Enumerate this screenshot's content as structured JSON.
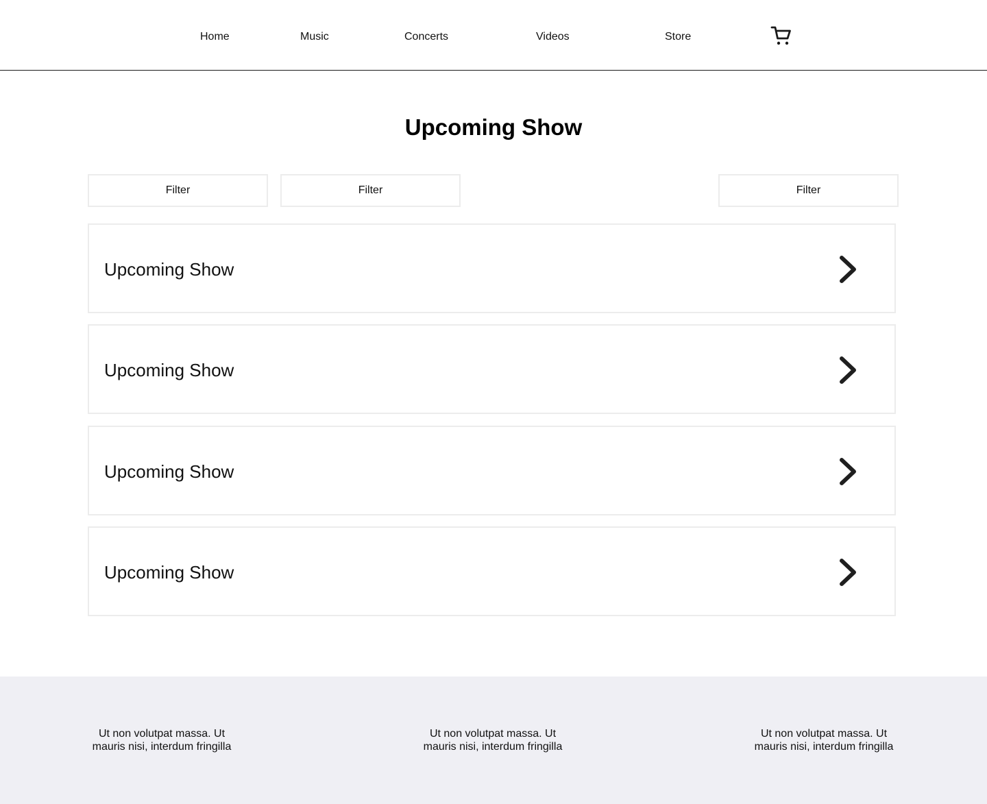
{
  "nav": {
    "items": [
      {
        "label": "Home"
      },
      {
        "label": "Music"
      },
      {
        "label": "Concerts"
      },
      {
        "label": "Videos"
      },
      {
        "label": "Store"
      }
    ],
    "cart_icon": "cart-icon"
  },
  "main": {
    "title": "Upcoming Show",
    "filters": [
      {
        "label": "Filter"
      },
      {
        "label": "Filter"
      },
      {
        "label": "Filter"
      }
    ],
    "shows": [
      {
        "label": "Upcoming Show",
        "icon": "chevron-right-icon"
      },
      {
        "label": "Upcoming Show",
        "icon": "chevron-right-icon"
      },
      {
        "label": "Upcoming Show",
        "icon": "chevron-right-icon"
      },
      {
        "label": "Upcoming Show",
        "icon": "chevron-right-icon"
      }
    ]
  },
  "footer": {
    "columns": [
      {
        "line1": "Ut non volutpat massa. Ut",
        "line2": "mauris nisi, interdum fringilla"
      },
      {
        "line1": "Ut non volutpat massa. Ut",
        "line2": "mauris nisi, interdum fringilla"
      },
      {
        "line1": "Ut non volutpat massa. Ut",
        "line2": "mauris nisi, interdum fringilla"
      }
    ],
    "background": "#efeff4"
  },
  "colors": {
    "text": "#111111",
    "border": "#ececec",
    "divider": "#1a1a1a"
  }
}
